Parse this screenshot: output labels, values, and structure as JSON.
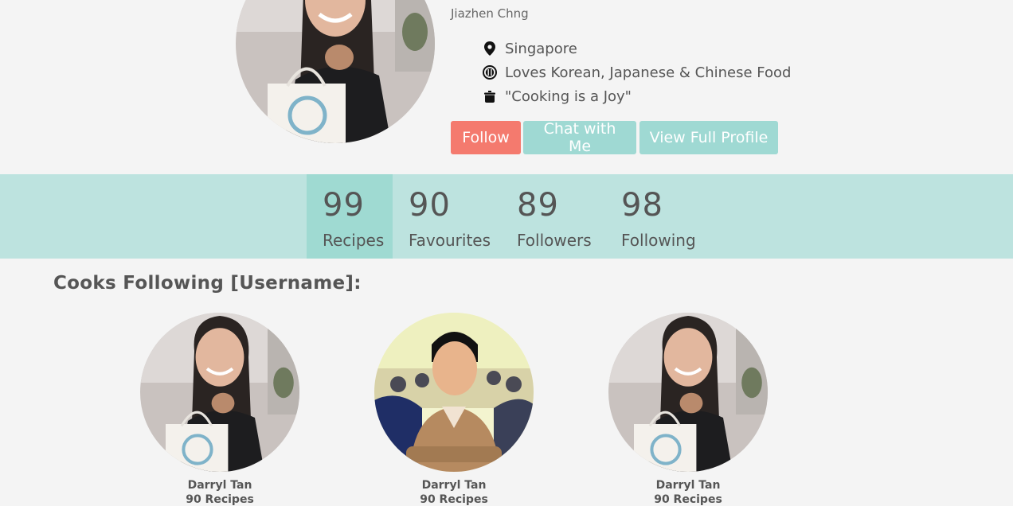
{
  "profile": {
    "name": "Jiazhen Chng",
    "location": "Singapore",
    "food": "Loves Korean, Japanese & Chinese Food",
    "motto": "\"Cooking is a Joy\"",
    "icons": [
      "map-pin-icon",
      "utensils-icon",
      "pot-icon"
    ]
  },
  "actions": {
    "follow": "Follow",
    "chat": "Chat with Me",
    "view_profile": "View Full Profile"
  },
  "stats": [
    {
      "value": "99",
      "label": "Recipes"
    },
    {
      "value": "90",
      "label": "Favourites"
    },
    {
      "value": "89",
      "label": "Followers"
    },
    {
      "value": "98",
      "label": "Following"
    }
  ],
  "section": {
    "title": "Cooks Following [Username]:"
  },
  "cooks": [
    {
      "name": "Darryl Tan",
      "recipes": "90 Recipes"
    },
    {
      "name": "Darryl Tan",
      "recipes": "90 Recipes"
    },
    {
      "name": "Darryl Tan",
      "recipes": "90 Recipes"
    }
  ],
  "colors": {
    "follow": "#f47a6e",
    "teal_button": "#9fd9d3",
    "stats_bar": "#bde3df",
    "stats_active": "#9fdad2",
    "background": "#f4f4f4"
  }
}
